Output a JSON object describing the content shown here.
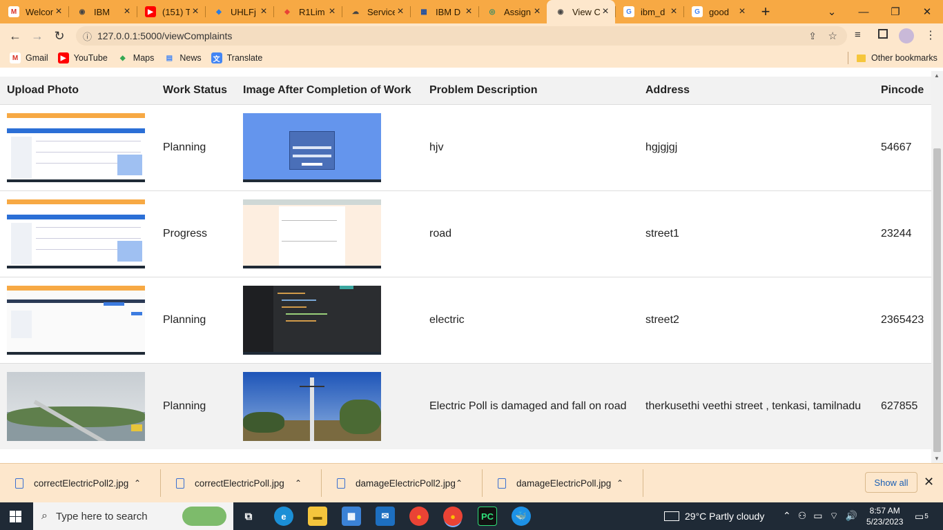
{
  "browser": {
    "tabs": [
      {
        "title": "Welcome",
        "fav": "M",
        "fav_bg": "#ffffff",
        "fav_color": "#d93025"
      },
      {
        "title": "IBM",
        "fav": "◉",
        "fav_bg": "transparent",
        "fav_color": "#444"
      },
      {
        "title": "(151) T",
        "fav": "▶",
        "fav_bg": "#ff0000",
        "fav_color": "#ffffff"
      },
      {
        "title": "UHLFj",
        "fav": "◆",
        "fav_bg": "transparent",
        "fav_color": "#2a7de1"
      },
      {
        "title": "R1Lim",
        "fav": "◆",
        "fav_bg": "transparent",
        "fav_color": "#e94235"
      },
      {
        "title": "Service",
        "fav": "☁",
        "fav_bg": "transparent",
        "fav_color": "#444"
      },
      {
        "title": "IBM D",
        "fav": "▦",
        "fav_bg": "transparent",
        "fav_color": "#1d4ea3"
      },
      {
        "title": "Assign",
        "fav": "◎",
        "fav_bg": "transparent",
        "fav_color": "#2a8a6a"
      },
      {
        "title": "View C",
        "fav": "◉",
        "fav_bg": "transparent",
        "fav_color": "#444"
      },
      {
        "title": "ibm_d",
        "fav": "G",
        "fav_bg": "#ffffff",
        "fav_color": "#4285f4"
      },
      {
        "title": "good",
        "fav": "G",
        "fav_bg": "#ffffff",
        "fav_color": "#4285f4"
      }
    ],
    "url": "127.0.0.1:5000/viewComplaints",
    "bookmarks": [
      {
        "label": "Gmail",
        "icon": "M",
        "color": "#d93025",
        "bg": "#ffffff"
      },
      {
        "label": "YouTube",
        "icon": "▶",
        "color": "#ffffff",
        "bg": "#ff0000"
      },
      {
        "label": "Maps",
        "icon": "◆",
        "color": "#34a853",
        "bg": "transparent"
      },
      {
        "label": "News",
        "icon": "▤",
        "color": "#4285f4",
        "bg": "transparent"
      },
      {
        "label": "Translate",
        "icon": "文",
        "color": "#ffffff",
        "bg": "#4285f4"
      }
    ],
    "other_bookmarks": "Other bookmarks"
  },
  "table": {
    "headers": [
      "Upload Photo",
      "Work Status",
      "Image After Completion of Work",
      "Problem Description",
      "Address",
      "Pincode"
    ],
    "rows": [
      {
        "status": "Planning",
        "description": "hjv",
        "address": "hgjgjgj",
        "pincode": "54667",
        "photo": "screen-blue",
        "after": "login"
      },
      {
        "status": "Progress",
        "description": "road",
        "address": "street1",
        "pincode": "23244",
        "photo": "screen-blue",
        "after": "quiz"
      },
      {
        "status": "Planning",
        "description": "electric",
        "address": "street2",
        "pincode": "2365423",
        "photo": "screen-white",
        "after": "code"
      },
      {
        "status": "Planning",
        "description": "Electric Poll is damaged and fall on road",
        "address": "therkusethi veethi street , tenkasi, tamilnadu",
        "pincode": "627855",
        "photo": "damaged-pole",
        "after": "pole"
      }
    ]
  },
  "downloads": {
    "items": [
      "correctElectricPoll2.jpg",
      "correctElectricPoll.jpg",
      "damageElectricPoll2.jpg",
      "damageElectricPoll.jpg"
    ],
    "show_all": "Show all"
  },
  "taskbar": {
    "search_placeholder": "Type here to search",
    "weather": "29°C  Partly cloudy",
    "time": "8:57 AM",
    "date": "5/23/2023",
    "notifications": "5"
  }
}
